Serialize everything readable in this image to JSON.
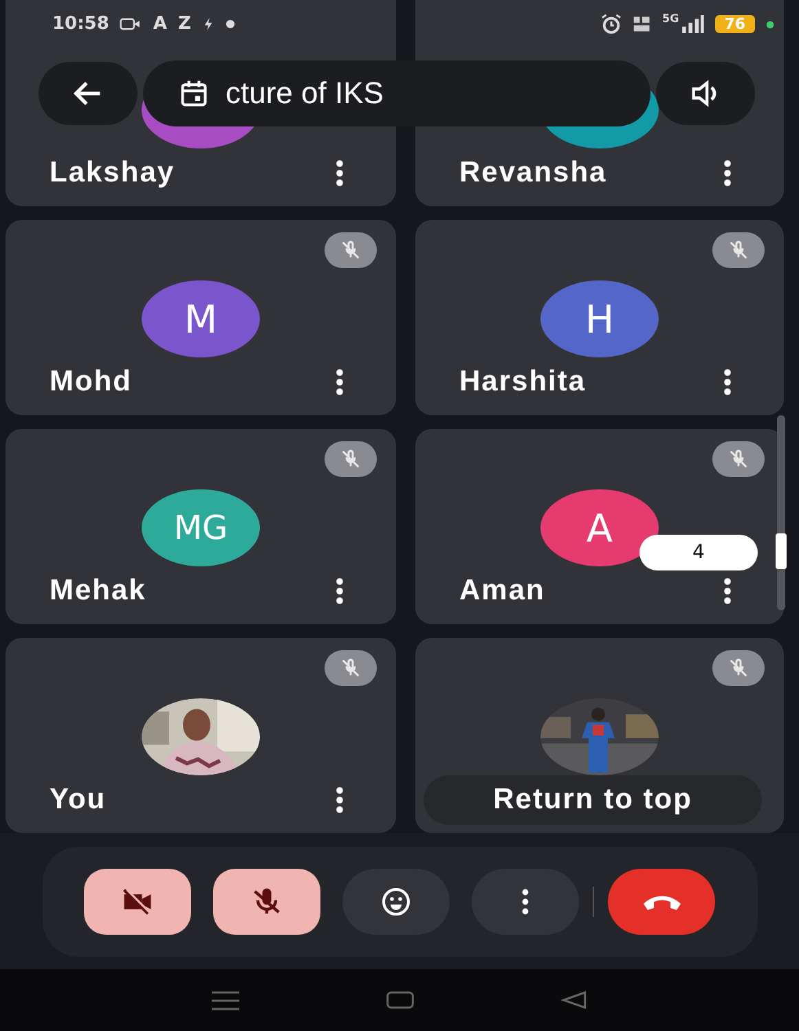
{
  "status_bar": {
    "time": "10:58",
    "notification_glyphs": [
      "A",
      "Z"
    ],
    "network": "5G",
    "battery": "76"
  },
  "top_bar": {
    "meeting_title": "cture of IKS"
  },
  "tiles": [
    {
      "name": "Lakshay",
      "kind": "avatar",
      "color": "#a84cc4",
      "muted": false,
      "menu": true
    },
    {
      "name": "Revansha",
      "kind": "avatar",
      "color": "#129aa6",
      "muted": false,
      "menu": true
    },
    {
      "name": "Mohd",
      "kind": "avatar",
      "initials": "M",
      "color": "#7a55cc",
      "muted": true,
      "menu": true
    },
    {
      "name": "Harshita",
      "kind": "avatar",
      "initials": "H",
      "color": "#5466c8",
      "muted": true,
      "menu": true
    },
    {
      "name": "Mehak",
      "kind": "avatar",
      "initials": "MG",
      "color": "#2eaa9a",
      "muted": true,
      "menu": true
    },
    {
      "name": "Aman",
      "kind": "avatar",
      "initials": "A",
      "color": "#e63b6f",
      "muted": true,
      "menu": true
    },
    {
      "name": "You",
      "kind": "picture",
      "muted": true,
      "menu": true
    },
    {
      "kind": "picture",
      "muted": true,
      "menu": false
    }
  ],
  "participant_count": "4",
  "return_to_top": "Return to top",
  "controls": [
    {
      "kind": "camera",
      "off": true
    },
    {
      "kind": "mic",
      "off": true
    },
    {
      "kind": "reactions",
      "off": false
    },
    {
      "kind": "more",
      "off": false
    },
    {
      "kind": "end_call",
      "off": false
    }
  ]
}
